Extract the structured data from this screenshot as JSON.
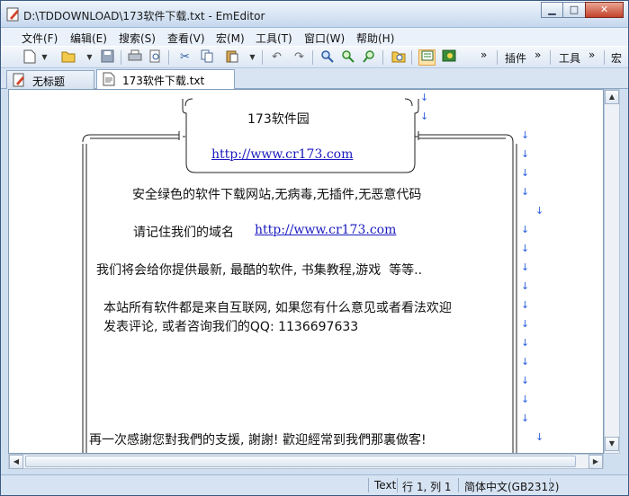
{
  "window": {
    "title": "D:\\TDDOWNLOAD\\173软件下载.txt - EmEditor",
    "minimize_glyph": "▁",
    "maximize_glyph": "□",
    "close_glyph": "✕"
  },
  "menu": [
    "文件(F)",
    "编辑(E)",
    "搜索(S)",
    "查看(V)",
    "宏(M)",
    "工具(T)",
    "窗口(W)",
    "帮助(H)"
  ],
  "toolbar": {
    "overflow_glyph": "»",
    "plugins_label": "插件",
    "tools_label": "工具",
    "macro_label": "宏",
    "icons": [
      "new-file",
      "open-folder",
      "save",
      "print",
      "print-preview",
      "cut",
      "copy",
      "paste",
      "undo",
      "redo",
      "find",
      "find-next",
      "find-prev",
      "find-in-files",
      "word-wrap",
      "view-mode"
    ]
  },
  "tabs": [
    {
      "label": "无标题"
    },
    {
      "label": "173软件下载.txt"
    }
  ],
  "document": {
    "box_title": "173软件园",
    "box_url": "http://www.cr173.com",
    "line_safe": "安全绿色的软件下载网站,无病毒,无插件,无恶意代码",
    "line_remember_prefix": "请记住我们的域名",
    "line_remember_url": "http://www.cr173.com",
    "line_provide": "我们将会给你提供最新, 最酷的软件, 书集教程,游戏  等等..",
    "line_source1": "本站所有软件都是来自互联网, 如果您有什么意见或者看法欢迎",
    "line_source2": "发表评论, 或者咨询我们的QQ: 1136697633",
    "line_thanks": "再一次感謝您對我們的支援, 謝謝! 歡迎經常到我們那裏做客!",
    "newline_glyph": "↓",
    "border_glyph": "‖"
  },
  "scrollbars": {
    "up": "▲",
    "down": "▼",
    "left": "◀",
    "right": "▶"
  },
  "status": {
    "mode": "Text",
    "position": "行 1, 列 1",
    "encoding": "简体中文(GB2312)"
  },
  "colors": {
    "link": "#1a1ac0",
    "newline_marker": "#2c5ee0",
    "title_bar": "#c6d8ee"
  }
}
